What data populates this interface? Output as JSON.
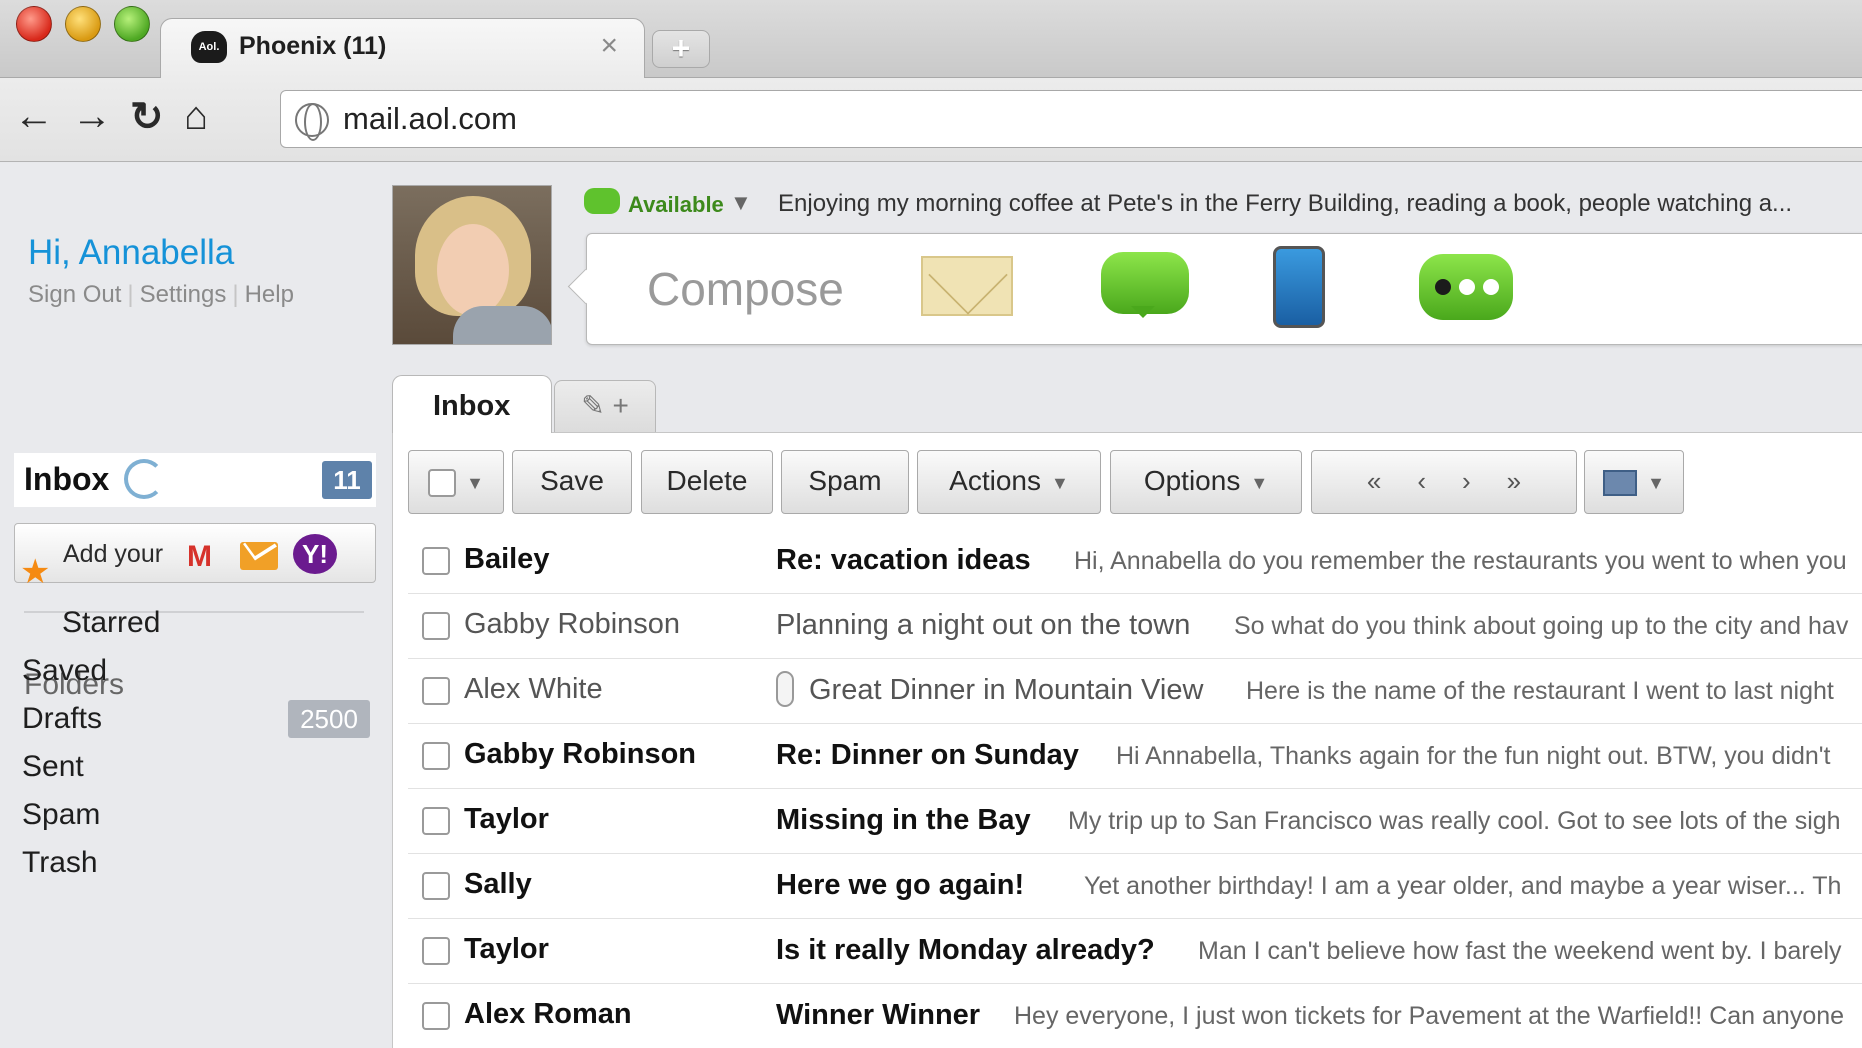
{
  "browser": {
    "tab_title": "Phoenix (11)",
    "tab_logo_text": "Aol.",
    "tab_close": "×",
    "new_tab": "+",
    "url": "mail.aol.com"
  },
  "account": {
    "greeting": "Hi, Annabella",
    "links": [
      "Sign Out",
      "Settings",
      "Help"
    ]
  },
  "sidebar": {
    "inbox_label": "Inbox",
    "inbox_count": "11",
    "add_your_label": "Add your",
    "folders_title": "Folders",
    "folders": [
      {
        "label": "Starred"
      },
      {
        "label": "Saved"
      },
      {
        "label": "Drafts",
        "count": "2500"
      },
      {
        "label": "Sent"
      },
      {
        "label": "Spam"
      },
      {
        "label": "Trash"
      }
    ]
  },
  "status": {
    "availability": "Available",
    "message": "Enjoying my morning coffee at Pete's in the Ferry Building, reading a book, people watching a..."
  },
  "compose": {
    "label": "Compose"
  },
  "mail_tabs": {
    "active": "Inbox"
  },
  "toolbar": {
    "buttons": [
      "Save",
      "Delete",
      "Spam",
      "Actions",
      "Options"
    ],
    "pager": [
      "«",
      "‹",
      "›",
      "»"
    ]
  },
  "messages": [
    {
      "sender": "Bailey",
      "subject": "Re: vacation ideas",
      "preview": "Hi, Annabella do you remember the restaurants you went to when you",
      "unread": true
    },
    {
      "sender": "Gabby Robinson",
      "subject": "Planning a night out on the town",
      "preview": "So what do you think about going up to the city and hav",
      "unread": false
    },
    {
      "sender": "Alex White",
      "subject": "Great Dinner in Mountain View",
      "preview": "Here is the name of the restaurant I went to last night",
      "unread": false,
      "attachment": true
    },
    {
      "sender": "Gabby Robinson",
      "subject": "Re: Dinner on Sunday",
      "preview": "Hi Annabella, Thanks again for the fun night out. BTW, you didn't",
      "unread": true
    },
    {
      "sender": "Taylor",
      "subject": "Missing in the Bay",
      "preview": "My trip up to San Francisco was really cool. Got to see lots of the sigh",
      "unread": true
    },
    {
      "sender": "Sally",
      "subject": "Here we go again!",
      "preview": "Yet another birthday! I am a year older, and maybe a year wiser... Th",
      "unread": true
    },
    {
      "sender": "Taylor",
      "subject": "Is it really Monday already?",
      "preview": "Man I can't believe how fast the weekend went by. I barely",
      "unread": true
    },
    {
      "sender": "Alex Roman",
      "subject": "Winner Winner",
      "preview": "Hey everyone, I just won tickets for Pavement at the Warfield!! Can anyone",
      "unread": true
    }
  ],
  "colors": {
    "accent_blue": "#1592d8",
    "badge_blue": "#5e82aa",
    "available_green": "#5fc22d",
    "star_orange": "#f58a12"
  }
}
